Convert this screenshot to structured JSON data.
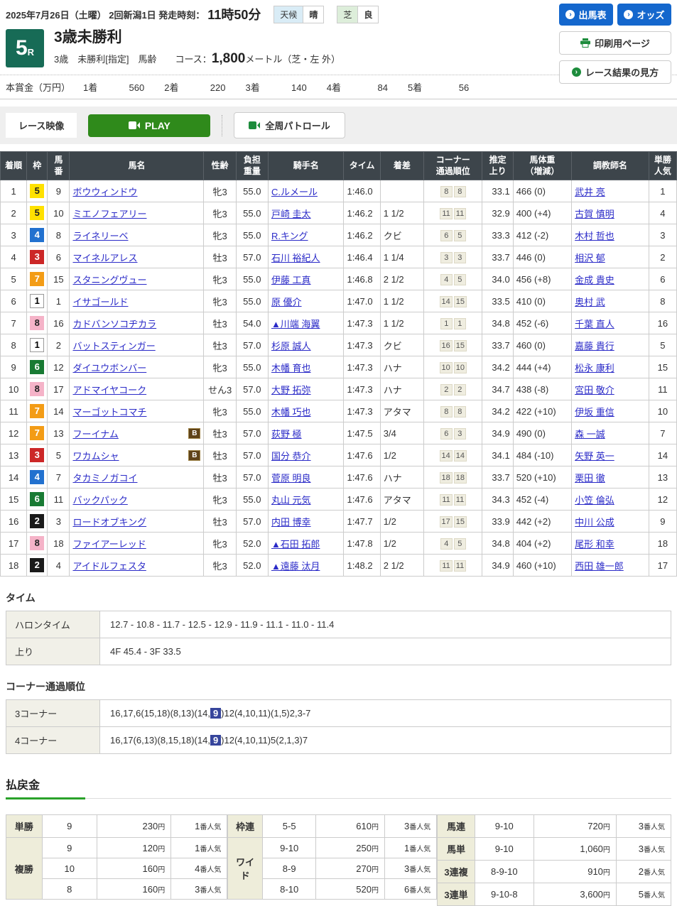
{
  "colors": {
    "accent_blue": "#1467cd",
    "accent_green": "#2f8a1b",
    "race_badge_green": "#176b56",
    "table_header_bg": "#3d454b",
    "link_blue": "#2b2bc8",
    "payout_label_bg": "#eeedda",
    "corner_highlight": "#36459c"
  },
  "header": {
    "date_line": "2025年7月26日（土曜）  2回新潟1日  発走時刻：",
    "start_time": "11時50分",
    "weather_label": "天候",
    "weather_value": "晴",
    "turf_label": "芝",
    "turf_value": "良",
    "btn_shutsuba": "出馬表",
    "btn_odds": "オッズ",
    "btn_print": "印刷用ページ",
    "btn_guide": "レース結果の見方",
    "arrow_icon": "›"
  },
  "race": {
    "number": "5",
    "number_suffix": "R",
    "title": "3歳未勝利",
    "conditions": "3歳　未勝利[指定]　馬齢　　コース：",
    "distance": "1,800",
    "distance_unit": "メートル（芝・左 外）"
  },
  "prize": {
    "label": "本賞金（万円）",
    "items": [
      {
        "place": "1着",
        "amount": "560"
      },
      {
        "place": "2着",
        "amount": "220"
      },
      {
        "place": "3着",
        "amount": "140"
      },
      {
        "place": "4着",
        "amount": "84"
      },
      {
        "place": "5着",
        "amount": "56"
      }
    ]
  },
  "video": {
    "label": "レース映像",
    "play": "PLAY",
    "patrol": "全周パトロール"
  },
  "results": {
    "headers": [
      "着順",
      "枠",
      "馬\n番",
      "馬名",
      "性齢",
      "負担\n重量",
      "騎手名",
      "タイム",
      "着差",
      "コーナー\n通過順位",
      "推定\n上り",
      "馬体重\n（増減）",
      "調教師名",
      "単勝\n人気"
    ],
    "rows": [
      {
        "finish": "1",
        "frame": "5",
        "number": "9",
        "horse": "ボウウィンドウ",
        "b": false,
        "sexage": "牝3",
        "weight": "55.0",
        "jockey": "C.ルメール",
        "time": "1:46.0",
        "margin": "",
        "corners": [
          "8",
          "8"
        ],
        "last3f": "33.1",
        "bodyweight": "466 (0)",
        "trainer": "武井 亮",
        "popularity": "1"
      },
      {
        "finish": "2",
        "frame": "5",
        "number": "10",
        "horse": "ミエノフェアリー",
        "b": false,
        "sexage": "牝3",
        "weight": "55.0",
        "jockey": "戸崎 圭太",
        "time": "1:46.2",
        "margin": "1 1/2",
        "corners": [
          "11",
          "11"
        ],
        "last3f": "32.9",
        "bodyweight": "400 (+4)",
        "trainer": "古賀 慎明",
        "popularity": "4"
      },
      {
        "finish": "3",
        "frame": "4",
        "number": "8",
        "horse": "ライネリーベ",
        "b": false,
        "sexage": "牝3",
        "weight": "55.0",
        "jockey": "R.キング",
        "time": "1:46.2",
        "margin": "クビ",
        "corners": [
          "6",
          "5"
        ],
        "last3f": "33.3",
        "bodyweight": "412 (-2)",
        "trainer": "木村 哲也",
        "popularity": "3"
      },
      {
        "finish": "4",
        "frame": "3",
        "number": "6",
        "horse": "マイネルアレス",
        "b": false,
        "sexage": "牡3",
        "weight": "57.0",
        "jockey": "石川 裕紀人",
        "time": "1:46.4",
        "margin": "1 1/4",
        "corners": [
          "3",
          "3"
        ],
        "last3f": "33.7",
        "bodyweight": "446 (0)",
        "trainer": "相沢 郁",
        "popularity": "2"
      },
      {
        "finish": "5",
        "frame": "7",
        "number": "15",
        "horse": "スタニングヴュー",
        "b": false,
        "sexage": "牝3",
        "weight": "55.0",
        "jockey": "伊藤 工真",
        "time": "1:46.8",
        "margin": "2 1/2",
        "corners": [
          "4",
          "5"
        ],
        "last3f": "34.0",
        "bodyweight": "456 (+8)",
        "trainer": "金成 貴史",
        "popularity": "6"
      },
      {
        "finish": "6",
        "frame": "1",
        "number": "1",
        "horse": "イサゴールド",
        "b": false,
        "sexage": "牝3",
        "weight": "55.0",
        "jockey": "原 優介",
        "time": "1:47.0",
        "margin": "1 1/2",
        "corners": [
          "14",
          "15"
        ],
        "last3f": "33.5",
        "bodyweight": "410 (0)",
        "trainer": "奥村 武",
        "popularity": "8"
      },
      {
        "finish": "7",
        "frame": "8",
        "number": "16",
        "horse": "カドバンソコヂカラ",
        "b": false,
        "sexage": "牡3",
        "weight": "54.0",
        "jockey": "▲川端 海翼",
        "time": "1:47.3",
        "margin": "1 1/2",
        "corners": [
          "1",
          "1"
        ],
        "last3f": "34.8",
        "bodyweight": "452 (-6)",
        "trainer": "千葉 直人",
        "popularity": "16"
      },
      {
        "finish": "8",
        "frame": "1",
        "number": "2",
        "horse": "バットスティンガー",
        "b": false,
        "sexage": "牡3",
        "weight": "57.0",
        "jockey": "杉原 誠人",
        "time": "1:47.3",
        "margin": "クビ",
        "corners": [
          "16",
          "15"
        ],
        "last3f": "33.7",
        "bodyweight": "460 (0)",
        "trainer": "嘉藤 貴行",
        "popularity": "5"
      },
      {
        "finish": "9",
        "frame": "6",
        "number": "12",
        "horse": "ダイユウボンバー",
        "b": false,
        "sexage": "牝3",
        "weight": "55.0",
        "jockey": "木幡 育也",
        "time": "1:47.3",
        "margin": "ハナ",
        "corners": [
          "10",
          "10"
        ],
        "last3f": "34.2",
        "bodyweight": "444 (+4)",
        "trainer": "松永 康利",
        "popularity": "15"
      },
      {
        "finish": "10",
        "frame": "8",
        "number": "17",
        "horse": "アドマイヤコーク",
        "b": false,
        "sexage": "せん3",
        "weight": "57.0",
        "jockey": "大野 拓弥",
        "time": "1:47.3",
        "margin": "ハナ",
        "corners": [
          "2",
          "2"
        ],
        "last3f": "34.7",
        "bodyweight": "438 (-8)",
        "trainer": "宮田 敬介",
        "popularity": "11"
      },
      {
        "finish": "11",
        "frame": "7",
        "number": "14",
        "horse": "マーゴットコマチ",
        "b": false,
        "sexage": "牝3",
        "weight": "55.0",
        "jockey": "木幡 巧也",
        "time": "1:47.3",
        "margin": "アタマ",
        "corners": [
          "8",
          "8"
        ],
        "last3f": "34.2",
        "bodyweight": "422 (+10)",
        "trainer": "伊坂 重信",
        "popularity": "10"
      },
      {
        "finish": "12",
        "frame": "7",
        "number": "13",
        "horse": "フーイナム",
        "b": true,
        "sexage": "牡3",
        "weight": "57.0",
        "jockey": "荻野 極",
        "time": "1:47.5",
        "margin": "3/4",
        "corners": [
          "6",
          "3"
        ],
        "last3f": "34.9",
        "bodyweight": "490 (0)",
        "trainer": "森 一誠",
        "popularity": "7"
      },
      {
        "finish": "13",
        "frame": "3",
        "number": "5",
        "horse": "ワカムシャ",
        "b": true,
        "sexage": "牡3",
        "weight": "57.0",
        "jockey": "国分 恭介",
        "time": "1:47.6",
        "margin": "1/2",
        "corners": [
          "14",
          "14"
        ],
        "last3f": "34.1",
        "bodyweight": "484 (-10)",
        "trainer": "矢野 英一",
        "popularity": "14"
      },
      {
        "finish": "14",
        "frame": "4",
        "number": "7",
        "horse": "タカミノガコイ",
        "b": false,
        "sexage": "牡3",
        "weight": "57.0",
        "jockey": "菅原 明良",
        "time": "1:47.6",
        "margin": "ハナ",
        "corners": [
          "18",
          "18"
        ],
        "last3f": "33.7",
        "bodyweight": "520 (+10)",
        "trainer": "栗田 徹",
        "popularity": "13"
      },
      {
        "finish": "15",
        "frame": "6",
        "number": "11",
        "horse": "バックパック",
        "b": false,
        "sexage": "牝3",
        "weight": "55.0",
        "jockey": "丸山 元気",
        "time": "1:47.6",
        "margin": "アタマ",
        "corners": [
          "11",
          "11"
        ],
        "last3f": "34.3",
        "bodyweight": "452 (-4)",
        "trainer": "小笠 倫弘",
        "popularity": "12"
      },
      {
        "finish": "16",
        "frame": "2",
        "number": "3",
        "horse": "ロードオブキング",
        "b": false,
        "sexage": "牡3",
        "weight": "57.0",
        "jockey": "内田 博幸",
        "time": "1:47.7",
        "margin": "1/2",
        "corners": [
          "17",
          "15"
        ],
        "last3f": "33.9",
        "bodyweight": "442 (+2)",
        "trainer": "中川 公成",
        "popularity": "9"
      },
      {
        "finish": "17",
        "frame": "8",
        "number": "18",
        "horse": "ファイアーレッド",
        "b": false,
        "sexage": "牝3",
        "weight": "52.0",
        "jockey": "▲石田 拓郎",
        "time": "1:47.8",
        "margin": "1/2",
        "corners": [
          "4",
          "5"
        ],
        "last3f": "34.8",
        "bodyweight": "404 (+2)",
        "trainer": "尾形 和幸",
        "popularity": "18"
      },
      {
        "finish": "18",
        "frame": "2",
        "number": "4",
        "horse": "アイドルフェスタ",
        "b": false,
        "sexage": "牝3",
        "weight": "52.0",
        "jockey": "▲遠藤 汰月",
        "time": "1:48.2",
        "margin": "2 1/2",
        "corners": [
          "11",
          "11"
        ],
        "last3f": "34.9",
        "bodyweight": "460 (+10)",
        "trainer": "西田 雄一郎",
        "popularity": "17"
      }
    ]
  },
  "time_section": {
    "title": "タイム",
    "rows": [
      {
        "label": "ハロンタイム",
        "value": "12.7 - 10.8 - 11.7 - 12.5 - 12.9 - 11.9 - 11.1 - 11.0 - 11.4"
      },
      {
        "label": "上り",
        "value": "4F 45.4 - 3F 33.5"
      }
    ]
  },
  "corner_section": {
    "title": "コーナー通過順位",
    "rows": [
      {
        "label": "3コーナー",
        "pre": "16,17,6(15,18)(8,13)(14,",
        "highlight": "9",
        "post": ")12(4,10,11)(1,5)2,3-7"
      },
      {
        "label": "4コーナー",
        "pre": "16,17(6,13)(8,15,18)(14,",
        "highlight": "9",
        "post": ")12(4,10,11)5(2,1,3)7"
      }
    ]
  },
  "payout": {
    "title": "払戻金",
    "groups": [
      {
        "widths": [
          52,
          80,
          108,
          82
        ],
        "bets": [
          {
            "type": "単勝",
            "rows": [
              {
                "combo": "9",
                "amount": "230円",
                "pop": "1番人気"
              }
            ]
          },
          {
            "type": "複勝",
            "rows": [
              {
                "combo": "9",
                "amount": "120円",
                "pop": "1番人気"
              },
              {
                "combo": "10",
                "amount": "160円",
                "pop": "4番人気"
              },
              {
                "combo": "8",
                "amount": "160円",
                "pop": "3番人気"
              }
            ]
          }
        ]
      },
      {
        "widths": [
          50,
          78,
          100,
          76
        ],
        "bets": [
          {
            "type": "枠連",
            "rows": [
              {
                "combo": "5-5",
                "amount": "610円",
                "pop": "3番人気"
              }
            ]
          },
          {
            "type": "ワイド",
            "rows": [
              {
                "combo": "9-10",
                "amount": "250円",
                "pop": "1番人気"
              },
              {
                "combo": "8-9",
                "amount": "270円",
                "pop": "3番人気"
              },
              {
                "combo": "8-10",
                "amount": "520円",
                "pop": "6番人気"
              }
            ]
          }
        ]
      },
      {
        "widths": [
          54,
          86,
          120,
          80
        ],
        "bets": [
          {
            "type": "馬連",
            "rows": [
              {
                "combo": "9-10",
                "amount": "720円",
                "pop": "3番人気"
              }
            ]
          },
          {
            "type": "馬単",
            "rows": [
              {
                "combo": "9-10",
                "amount": "1,060円",
                "pop": "3番人気"
              }
            ]
          },
          {
            "type": "3連複",
            "rows": [
              {
                "combo": "8-9-10",
                "amount": "910円",
                "pop": "2番人気"
              }
            ]
          },
          {
            "type": "3連単",
            "rows": [
              {
                "combo": "9-10-8",
                "amount": "3,600円",
                "pop": "5番人気"
              }
            ]
          }
        ]
      }
    ]
  }
}
